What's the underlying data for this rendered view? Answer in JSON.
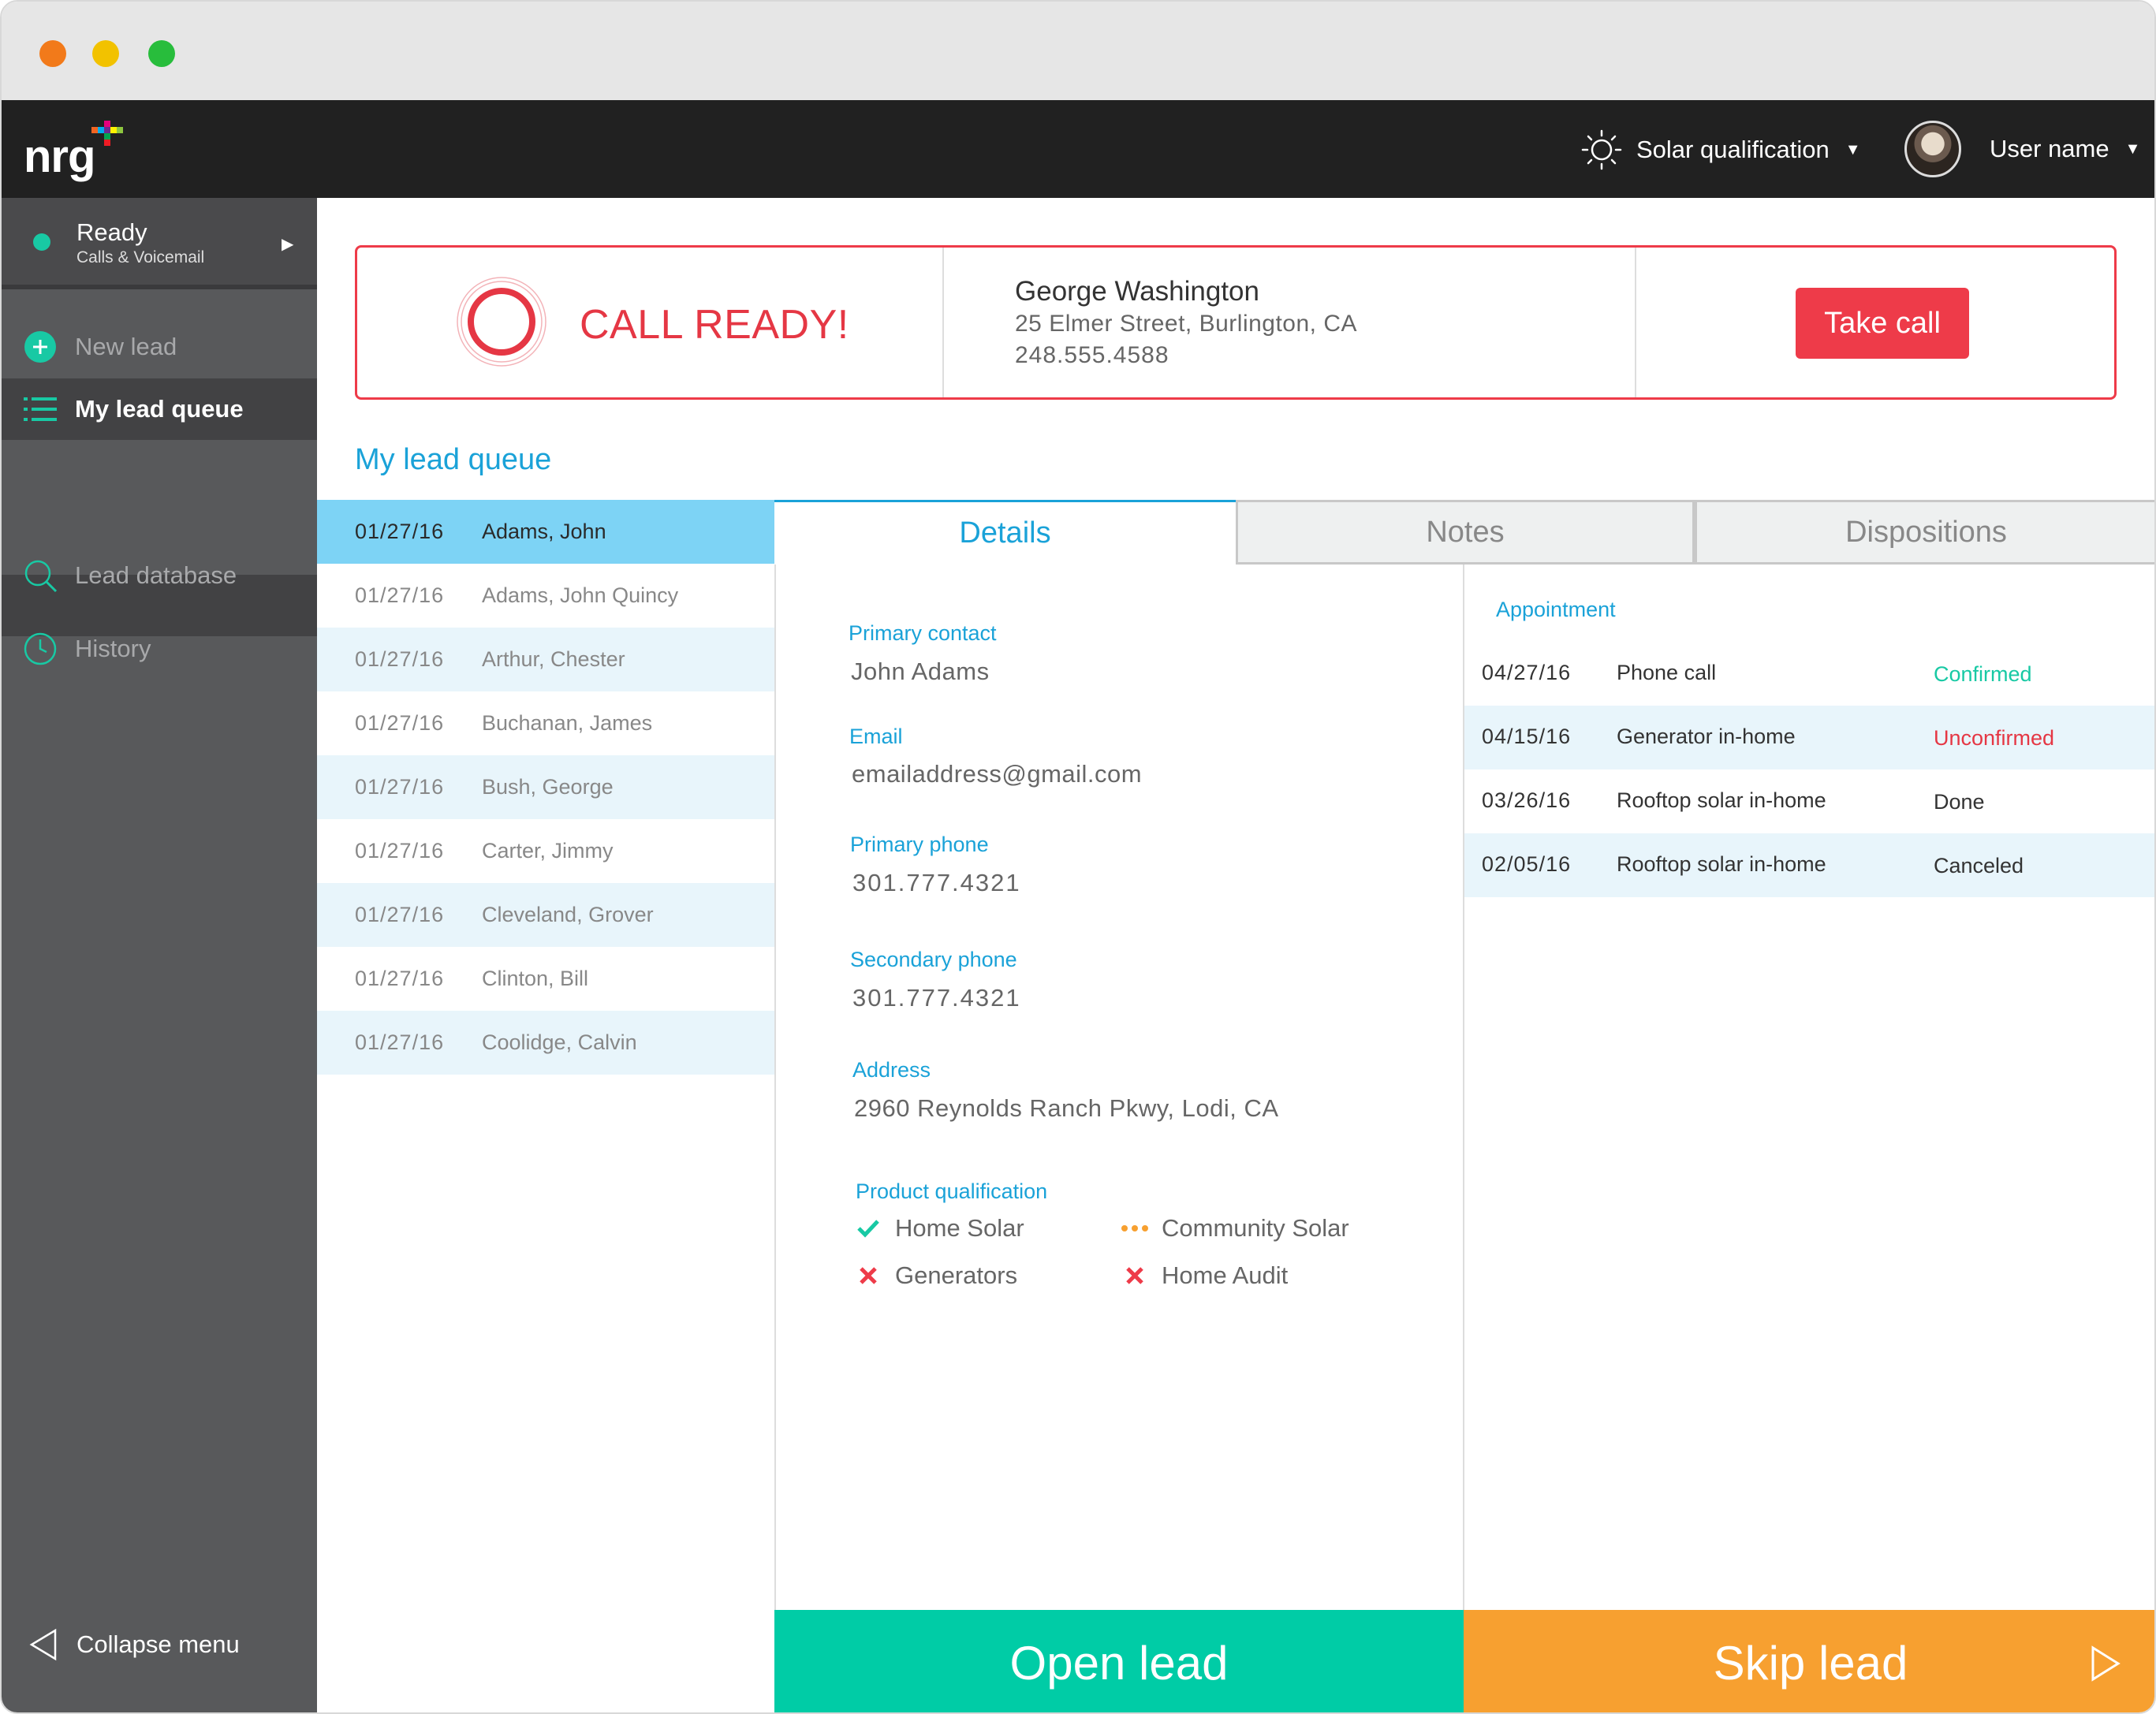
{
  "topbar": {
    "logo_text": "nrg",
    "solar_label": "Solar qualification",
    "user_label": "User name"
  },
  "sidebar": {
    "status_title": "Ready",
    "status_sub": "Calls & Voicemail",
    "items": [
      {
        "label": "New lead",
        "icon": "plus-circle-icon"
      },
      {
        "label": "My lead queue",
        "icon": "list-icon"
      },
      {
        "label": "Lead database",
        "icon": "search-icon"
      },
      {
        "label": "History",
        "icon": "clock-icon"
      }
    ],
    "collapse_label": "Collapse menu"
  },
  "call": {
    "status": "CALL READY!",
    "name": "George Washington",
    "address": "25 Elmer Street, Burlington, CA",
    "phone": "248.555.4588",
    "button": "Take call"
  },
  "queue": {
    "title": "My lead queue",
    "rows": [
      {
        "date": "01/27/16",
        "name": "Adams, John"
      },
      {
        "date": "01/27/16",
        "name": "Adams, John Quincy"
      },
      {
        "date": "01/27/16",
        "name": "Arthur, Chester"
      },
      {
        "date": "01/27/16",
        "name": "Buchanan, James"
      },
      {
        "date": "01/27/16",
        "name": "Bush, George"
      },
      {
        "date": "01/27/16",
        "name": "Carter, Jimmy"
      },
      {
        "date": "01/27/16",
        "name": "Cleveland, Grover"
      },
      {
        "date": "01/27/16",
        "name": "Clinton, Bill"
      },
      {
        "date": "01/27/16",
        "name": "Coolidge, Calvin"
      }
    ]
  },
  "tabs": {
    "details": "Details",
    "notes": "Notes",
    "dispositions": "Dispositions"
  },
  "details": {
    "primary_contact_label": "Primary contact",
    "primary_contact": "John Adams",
    "email_label": "Email",
    "email": "emailaddress@gmail.com",
    "primary_phone_label": "Primary phone",
    "primary_phone": "301.777.4321",
    "secondary_phone_label": "Secondary phone",
    "secondary_phone": "301.777.4321",
    "address_label": "Address",
    "address": "2960 Reynolds Ranch Pkwy, Lodi, CA",
    "product_label": "Product qualification",
    "products": [
      {
        "name": "Home Solar",
        "status": "check"
      },
      {
        "name": "Community Solar",
        "status": "pending"
      },
      {
        "name": "Generators",
        "status": "x"
      },
      {
        "name": "Home Audit",
        "status": "x"
      }
    ]
  },
  "appointments": {
    "label": "Appointment",
    "rows": [
      {
        "date": "04/27/16",
        "type": "Phone call",
        "status": "Confirmed",
        "color": "#18c9a4"
      },
      {
        "date": "04/15/16",
        "type": "Generator in-home",
        "status": "Unconfirmed",
        "color": "#e53744"
      },
      {
        "date": "03/26/16",
        "type": "Rooftop solar in-home",
        "status": "Done",
        "color": "#333333"
      },
      {
        "date": "02/05/16",
        "type": "Rooftop solar in-home",
        "status": "Canceled",
        "color": "#333333"
      }
    ]
  },
  "actions": {
    "open": "Open lead",
    "skip": "Skip lead"
  },
  "colors": {
    "accent": "#1aa2d8",
    "teal": "#00cca6",
    "orange": "#f7a030",
    "red": "#ee3b49"
  }
}
